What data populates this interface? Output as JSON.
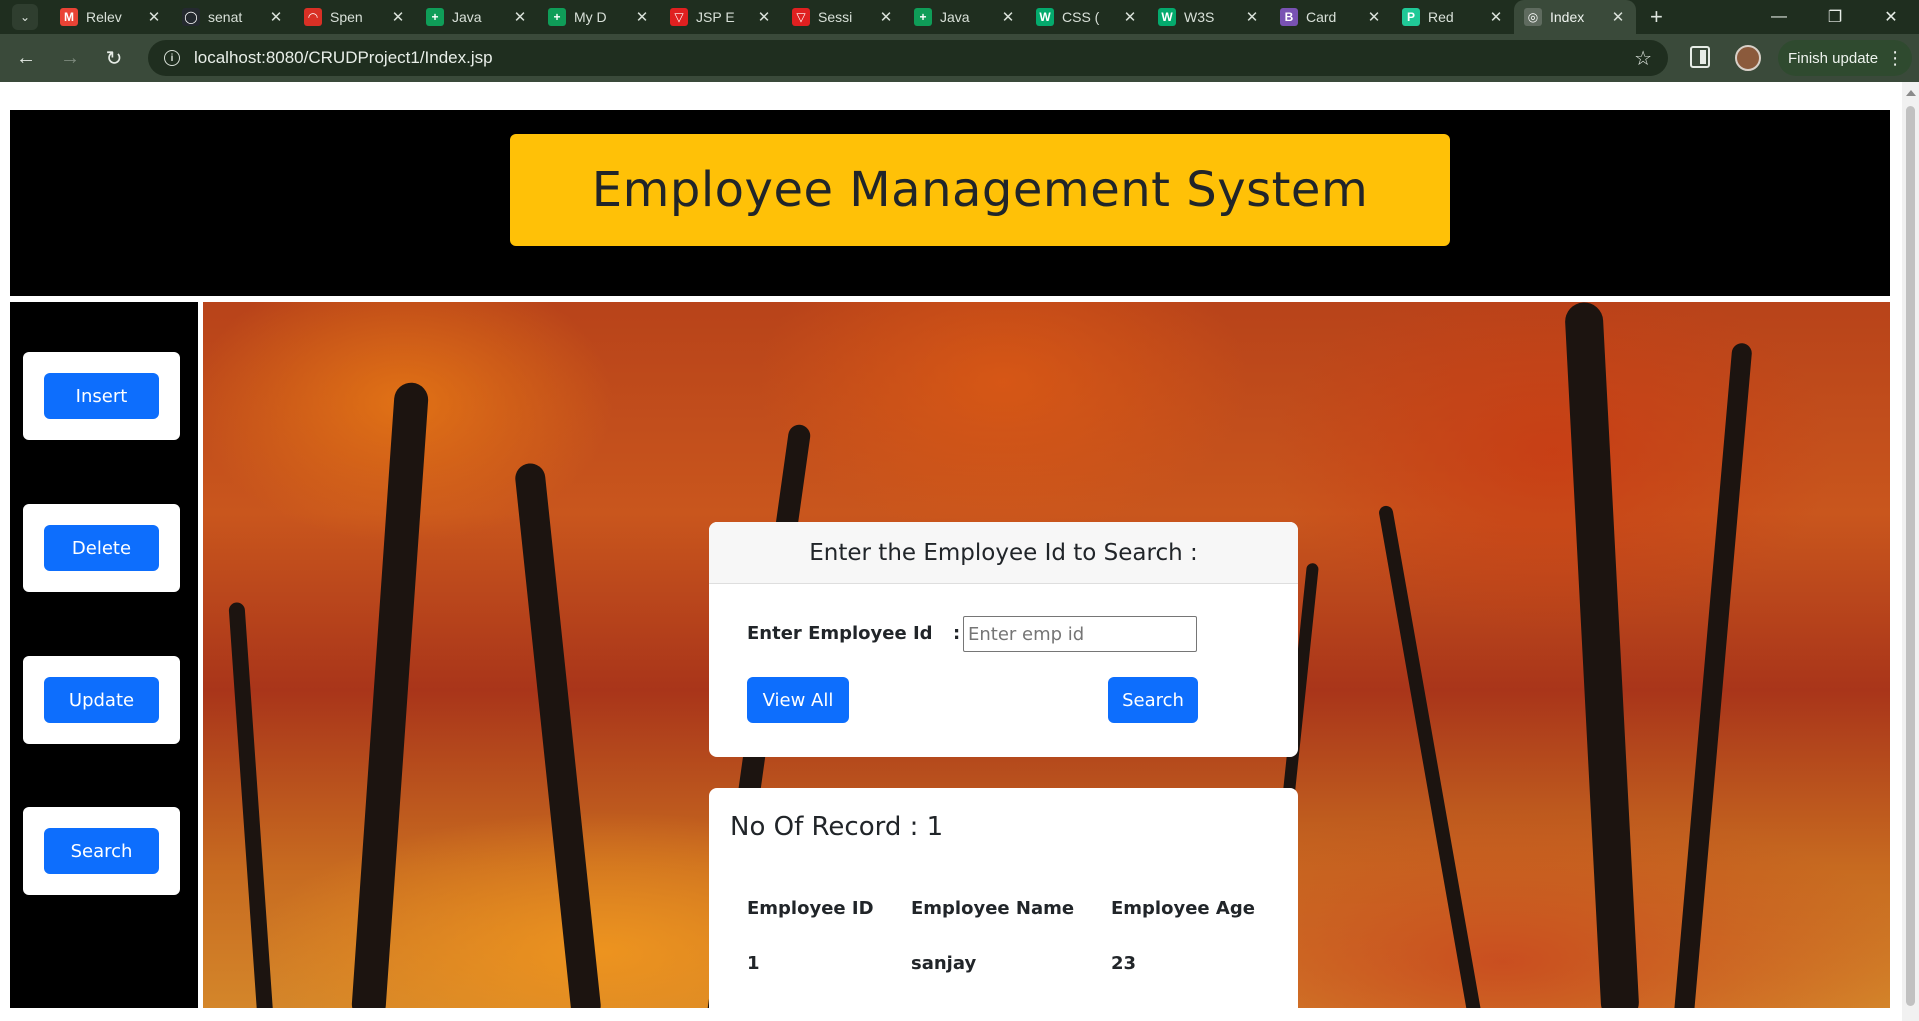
{
  "browser": {
    "tabs": [
      {
        "label": "Relev",
        "icon": "gmail-icon",
        "color": "#ea4335"
      },
      {
        "label": "senat",
        "icon": "github-icon",
        "color": "#24292f"
      },
      {
        "label": "Spen",
        "icon": "spend-icon",
        "color": "#d93025"
      },
      {
        "label": "Java",
        "icon": "sheets-icon",
        "color": "#0f9d58"
      },
      {
        "label": "My D",
        "icon": "sheets-icon",
        "color": "#0f9d58"
      },
      {
        "label": "JSP E",
        "icon": "vercel-icon",
        "color": "#e02020"
      },
      {
        "label": "Sessi",
        "icon": "vercel-icon",
        "color": "#e02020"
      },
      {
        "label": "Java",
        "icon": "sheets-icon",
        "color": "#0f9d58"
      },
      {
        "label": "CSS (",
        "icon": "w3schools-icon",
        "color": "#04aa6d"
      },
      {
        "label": "W3S",
        "icon": "w3schools-icon",
        "color": "#04aa6d"
      },
      {
        "label": "Card",
        "icon": "bootstrap-icon",
        "color": "#7952b3"
      },
      {
        "label": "Red",
        "icon": "page-icon",
        "color": "#20c997"
      },
      {
        "label": "Index",
        "icon": "globe-icon",
        "color": "#5f6b5f",
        "active": true
      }
    ],
    "url": "localhost:8080/CRUDProject1/Index.jsp",
    "finish_update": "Finish update"
  },
  "header": {
    "title": "Employee Management System"
  },
  "sidebar": {
    "buttons": [
      "Insert",
      "Delete",
      "Update",
      "Search"
    ]
  },
  "search": {
    "heading": "Enter the Employee Id to Search :",
    "label": "Enter Employee Id",
    "colon": ":",
    "placeholder": "Enter emp id",
    "view_all": "View All",
    "search_btn": "Search"
  },
  "results": {
    "record_count_text": "No Of Record : 1",
    "columns": [
      "Employee ID",
      "Employee Name",
      "Employee Age"
    ],
    "rows": [
      [
        "1",
        "sanjay",
        "23"
      ]
    ]
  },
  "colors": {
    "title_bg": "#ffc107",
    "primary_button": "#0d6efd",
    "header_bg": "#000000"
  }
}
